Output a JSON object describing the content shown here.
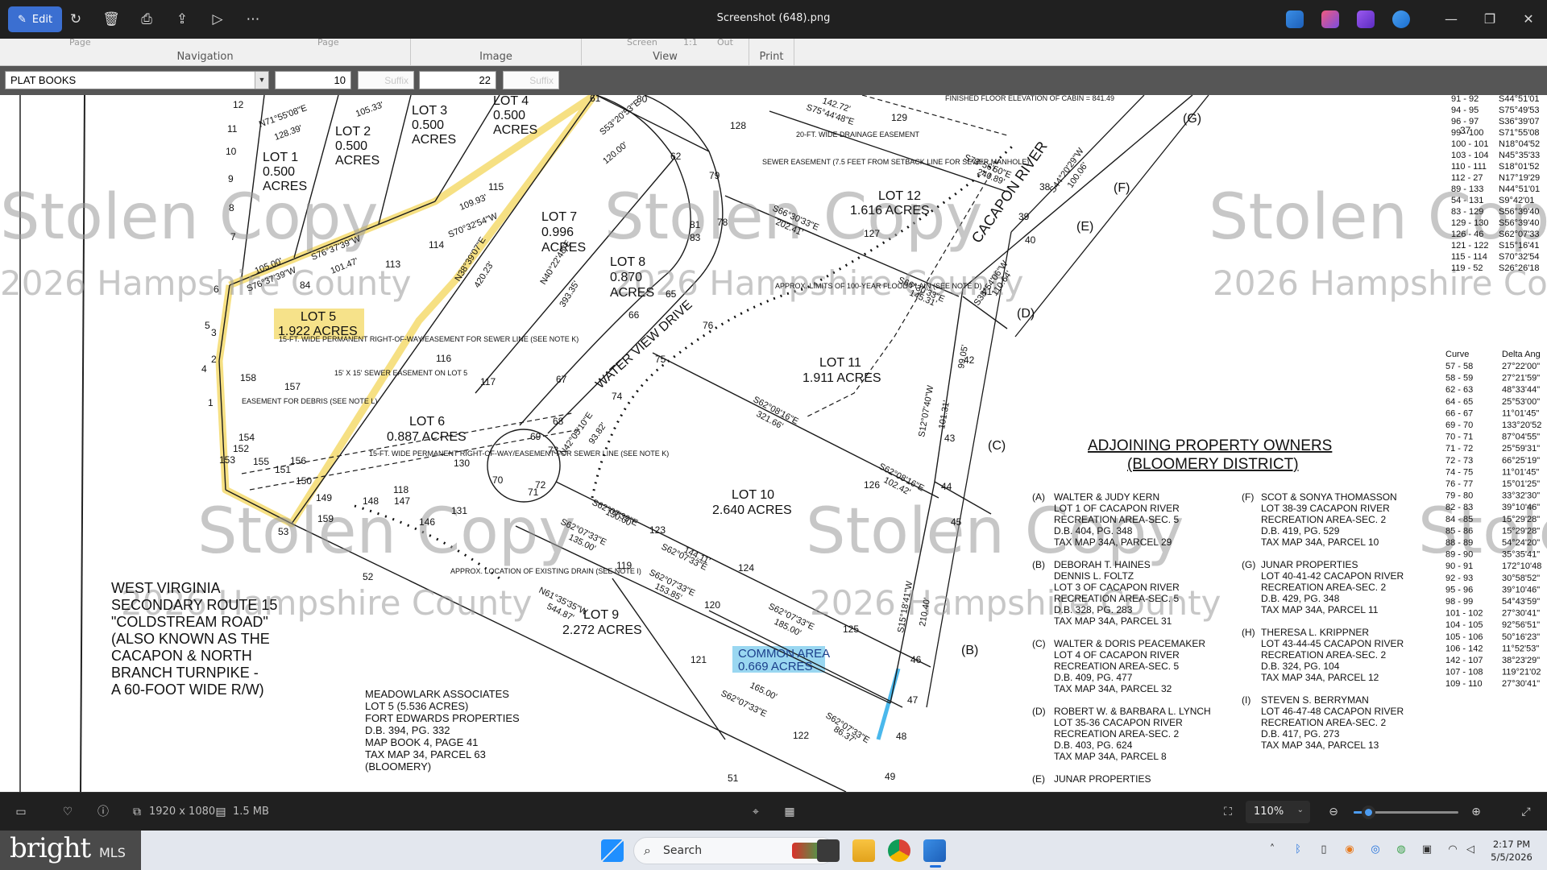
{
  "window": {
    "title": "Screenshot (648).png",
    "edit_label": "Edit"
  },
  "ribbon": {
    "groups": [
      {
        "label": "Navigation",
        "cut": [
          "Page",
          "Page"
        ]
      },
      {
        "label": "Image",
        "cut": []
      },
      {
        "label": "View",
        "cut": [
          "Screen",
          "1:1",
          "Out"
        ]
      },
      {
        "label": "Print",
        "cut": []
      }
    ]
  },
  "inputbar": {
    "book_type": "PLAT BOOKS",
    "book_number": "10",
    "book_suffix_placeholder": "Suffix",
    "page_number": "22",
    "page_suffix_placeholder": "Suffix"
  },
  "plat": {
    "watermarks": [
      "Stolen Copy",
      "Stolen Copy",
      "Stolen Copy",
      "Stolen Copy",
      "Stolen Copy",
      "Stolen Copy",
      "Stolen Copy"
    ],
    "watermark_county": [
      "2026 Hampshire County",
      "2026 Hampshire County",
      "2026 Hampshire Co",
      "2026 Hampshire County",
      "2026 Hampshire County"
    ],
    "lots": [
      {
        "name": "LOT 1",
        "acres": "0.500",
        "unit": "ACRES"
      },
      {
        "name": "LOT 2",
        "acres": "0.500",
        "unit": "ACRES"
      },
      {
        "name": "LOT 3",
        "acres": "0.500",
        "unit": "ACRES"
      },
      {
        "name": "LOT 4",
        "acres": "0.500",
        "unit": "ACRES"
      },
      {
        "name": "LOT 5",
        "acres": "1.922 ACRES"
      },
      {
        "name": "LOT 6",
        "acres": "0.887 ACRES"
      },
      {
        "name": "LOT 7",
        "acres": "0.996",
        "unit": "ACRES"
      },
      {
        "name": "LOT 8",
        "acres": "0.870",
        "unit": "ACRES"
      },
      {
        "name": "LOT 9",
        "acres": "2.272 ACRES"
      },
      {
        "name": "LOT 10",
        "acres": "2.640 ACRES"
      },
      {
        "name": "LOT 11",
        "acres": "1.911 ACRES"
      },
      {
        "name": "LOT 12",
        "acres": "1.616 ACRES"
      }
    ],
    "common_area": [
      "COMMON AREA",
      "0.669 ACRES"
    ],
    "road_labels": [
      "WATER VIEW DRIVE",
      "CACAPON RIVER"
    ],
    "route_note": [
      "WEST VIRGINIA",
      "SECONDARY ROUTE 15",
      "\"COLDSTREAM ROAD\"",
      "(ALSO KNOWN AS THE",
      "CACAPON & NORTH",
      "BRANCH TURNPIKE -",
      "A 60-FOOT WIDE R/W)"
    ],
    "meadowlark": [
      "MEADOWLARK ASSOCIATES",
      "LOT 5 (5.536 ACRES)",
      "FORT EDWARDS PROPERTIES",
      "D.B. 394, PG. 332",
      "MAP BOOK 4, PAGE 41",
      "TAX MAP 34, PARCEL 63",
      "(BLOOMERY)"
    ],
    "notes": [
      "15-FT. WIDE PERMANENT RIGHT-OF-WAY/EASEMENT FOR SEWER LINE (SEE NOTE K)",
      "15' X 15' SEWER EASEMENT ON LOT 5",
      "EASEMENT FOR DEBRIS (SEE NOTE L)",
      "APPROX. LOCATION OF EXISTING DRAIN (SEE NOTE I)",
      "SEWER EASEMENT (7.5 FEET FROM SETBACK LINE FOR SEWER MANHOLE)",
      "APPROX. LIMITS OF 100-YEAR FLOOD PLAIN (SEE NOTE D)",
      "FINISHED FLOOR ELEVATION OF CABIN = 841.49",
      "20-FT. WIDE DRAINAGE EASEMENT"
    ],
    "bearings": [
      "N71°55'08\"E",
      "128.39'",
      "105.33'",
      "S76°37'39\"W",
      "101.47'",
      "S76°37'39\"W",
      "105.00'",
      "S70°32'54\"W",
      "109.93'",
      "S53°20'53\"E",
      "120.00'",
      "N38°39'07\"E",
      "420.23'",
      "N40°22'48\"E",
      "393.35'",
      "S62°08'16\"E",
      "321.66'",
      "S62°08'16\"E",
      "102.42'",
      "S62°07'33\"E",
      "130.00'",
      "S62°07'33\"E",
      "135.00'",
      "S62°07'33\"E",
      "144.11'",
      "S62°07'33\"E",
      "153.85'",
      "S62°07'33\"E",
      "165.00'",
      "S62°07'33\"E",
      "185.00'",
      "N61°35'35\"W",
      "544.87'",
      "S62°07'33\"E",
      "86.37'",
      "S66°30'33\"E",
      "202.41'",
      "S66°30'33\"E",
      "145.31'",
      "S73°56'50\"E",
      "240.89'",
      "S75°44'48\"E",
      "142.72'",
      "N42°05'10\"E",
      "93.82'",
      "S12°07'40\"W",
      "101.31'",
      "S15°18'41\"W",
      "210.40'",
      "S38°54'06\"W",
      "110.64'",
      "S44°20'29\"W",
      "100.06'",
      "99.05'"
    ],
    "points": [
      "1",
      "2",
      "3",
      "4",
      "5",
      "6",
      "7",
      "8",
      "9",
      "10",
      "11",
      "12",
      "37",
      "38",
      "39",
      "40",
      "41",
      "42",
      "43",
      "44",
      "45",
      "46",
      "47",
      "48",
      "49",
      "51",
      "52",
      "53",
      "61",
      "62",
      "65",
      "66",
      "67",
      "68",
      "69",
      "70",
      "71",
      "72",
      "73",
      "74",
      "75",
      "76",
      "78",
      "79",
      "80",
      "81",
      "83",
      "84",
      "113",
      "114",
      "115",
      "116",
      "117",
      "118",
      "119",
      "120",
      "121",
      "122",
      "123",
      "124",
      "125",
      "126",
      "127",
      "128",
      "129",
      "130",
      "131",
      "146",
      "147",
      "148",
      "149",
      "150",
      "151",
      "152",
      "153",
      "154",
      "155",
      "156",
      "157",
      "158",
      "159",
      "160",
      "161"
    ],
    "side_letters": [
      "(A)",
      "(B)",
      "(C)",
      "(D)",
      "(E)",
      "(F)",
      "(G)"
    ],
    "adjoining_title": [
      "ADJOINING PROPERTY OWNERS",
      "(BLOOMERY DISTRICT)"
    ],
    "owners_left": [
      {
        "key": "(A)",
        "lines": [
          "WALTER & JUDY KERN",
          "LOT 1 OF CACAPON RIVER",
          "RECREATION AREA-SEC. 5",
          "D.B. 404, PG. 348",
          "TAX MAP 34A, PARCEL 29"
        ]
      },
      {
        "key": "(B)",
        "lines": [
          "DEBORAH T. HAINES",
          "DENNIS L. FOLTZ",
          "LOT 3 OF CACAPON RIVER",
          "RECREATION AREA-SEC. 5",
          "D.B. 328, PG. 283",
          "TAX MAP 34A, PARCEL 31"
        ]
      },
      {
        "key": "(C)",
        "lines": [
          "WALTER & DORIS PEACEMAKER",
          "LOT 4 OF CACAPON RIVER",
          "RECREATION AREA-SEC. 5",
          "D.B. 409, PG. 477",
          "TAX MAP 34A, PARCEL 32"
        ]
      },
      {
        "key": "(D)",
        "lines": [
          "ROBERT W. & BARBARA L. LYNCH",
          "LOT 35-36 CACAPON RIVER",
          "RECREATION AREA-SEC. 2",
          "D.B. 403, PG. 624",
          "TAX MAP 34A, PARCEL 8"
        ]
      },
      {
        "key": "(E)",
        "lines": [
          "JUNAR PROPERTIES"
        ]
      }
    ],
    "owners_right": [
      {
        "key": "(F)",
        "lines": [
          "SCOT & SONYA THOMASSON",
          "LOT 38-39 CACAPON RIVER",
          "RECREATION AREA-SEC. 2",
          "D.B. 419, PG. 529",
          "TAX MAP 34A, PARCEL 10"
        ]
      },
      {
        "key": "(G)",
        "lines": [
          "JUNAR PROPERTIES",
          "LOT 40-41-42 CACAPON RIVER",
          "RECREATION AREA-SEC. 2",
          "D.B. 429, PG. 348",
          "TAX MAP 34A, PARCEL 11"
        ]
      },
      {
        "key": "(H)",
        "lines": [
          "THERESA L. KRIPPNER",
          "LOT 43-44-45 CACAPON RIVER",
          "RECREATION AREA-SEC. 2",
          "D.B. 324, PG. 104",
          "TAX MAP 34A, PARCEL 12"
        ]
      },
      {
        "key": "(I)",
        "lines": [
          "STEVEN S. BERRYMAN",
          "LOT 46-47-48 CACAPON RIVER",
          "RECREATION AREA-SEC. 2",
          "D.B. 417, PG. 273",
          "TAX MAP 34A, PARCEL 13"
        ]
      }
    ],
    "line_table": [
      [
        "91 - 92",
        "S44°51'01"
      ],
      [
        "94 - 95",
        "S75°49'53"
      ],
      [
        "96 - 97",
        "S36°39'07"
      ],
      [
        "99 - 100",
        "S71°55'08"
      ],
      [
        "100 - 101",
        "N18°04'52"
      ],
      [
        "103 - 104",
        "N45°35'33"
      ],
      [
        "110 - 111",
        "S18°01'52"
      ],
      [
        "112 - 27",
        "N17°19'29"
      ],
      [
        "89 - 133",
        "N44°51'01"
      ],
      [
        "54 - 131",
        "S9°42'01"
      ],
      [
        "83 - 129",
        "S56°39'40"
      ],
      [
        "129 - 130",
        "S56°39'40"
      ],
      [
        "126 - 46",
        "S62°07'33"
      ],
      [
        "121 - 122",
        "S15°16'41"
      ],
      [
        "115 - 114",
        "S70°32'54"
      ],
      [
        "119 - 52",
        "S26°26'18"
      ]
    ],
    "curve_header": [
      "Curve",
      "Delta Ang"
    ],
    "curve_table": [
      [
        "57 - 58",
        "27°22'00\""
      ],
      [
        "58 - 59",
        "27°21'59\""
      ],
      [
        "62 - 63",
        "48°33'44\""
      ],
      [
        "64 - 65",
        "25°53'00\""
      ],
      [
        "66 - 67",
        "11°01'45\""
      ],
      [
        "69 - 70",
        "133°20'52"
      ],
      [
        "70 - 71",
        "87°04'55\""
      ],
      [
        "71 - 72",
        "25°59'31\""
      ],
      [
        "72 - 73",
        "66°25'19\""
      ],
      [
        "74 - 75",
        "11°01'45\""
      ],
      [
        "76 - 77",
        "15°01'25\""
      ],
      [
        "79 - 80",
        "33°32'30\""
      ],
      [
        "82 - 83",
        "39°10'46\""
      ],
      [
        "84 - 85",
        "15°29'28\""
      ],
      [
        "85 - 86",
        "15°29'28\""
      ],
      [
        "88 - 89",
        "54°24'20\""
      ],
      [
        "89 - 90",
        "35°35'41\""
      ],
      [
        "90 - 91",
        "172°10'48"
      ],
      [
        "92 - 93",
        "30°58'52\""
      ],
      [
        "95 - 96",
        "39°10'46\""
      ],
      [
        "98 - 99",
        "54°43'59\""
      ],
      [
        "101 - 102",
        "27°30'41\""
      ],
      [
        "104 - 105",
        "92°56'51\""
      ],
      [
        "105 - 106",
        "50°16'23\""
      ],
      [
        "106 - 142",
        "11°52'53\""
      ],
      [
        "142 - 107",
        "38°23'29\""
      ],
      [
        "107 - 108",
        "119°21'02"
      ],
      [
        "109 - 110",
        "27°30'41\""
      ]
    ]
  },
  "statusbar": {
    "dimensions": "1920 x 1080",
    "filesize": "1.5 MB",
    "zoom": "110%",
    "zoom_level_pct": 14
  },
  "taskbar": {
    "brand_main": "bright",
    "brand_sub": "MLS",
    "search_label": "Search",
    "time": "2:17 PM",
    "date": "5/5/2026"
  },
  "colors": {
    "accent": "#3b6fd1",
    "lot5_highlight": "#f5dd76",
    "common_highlight": "#8fd3f0"
  }
}
